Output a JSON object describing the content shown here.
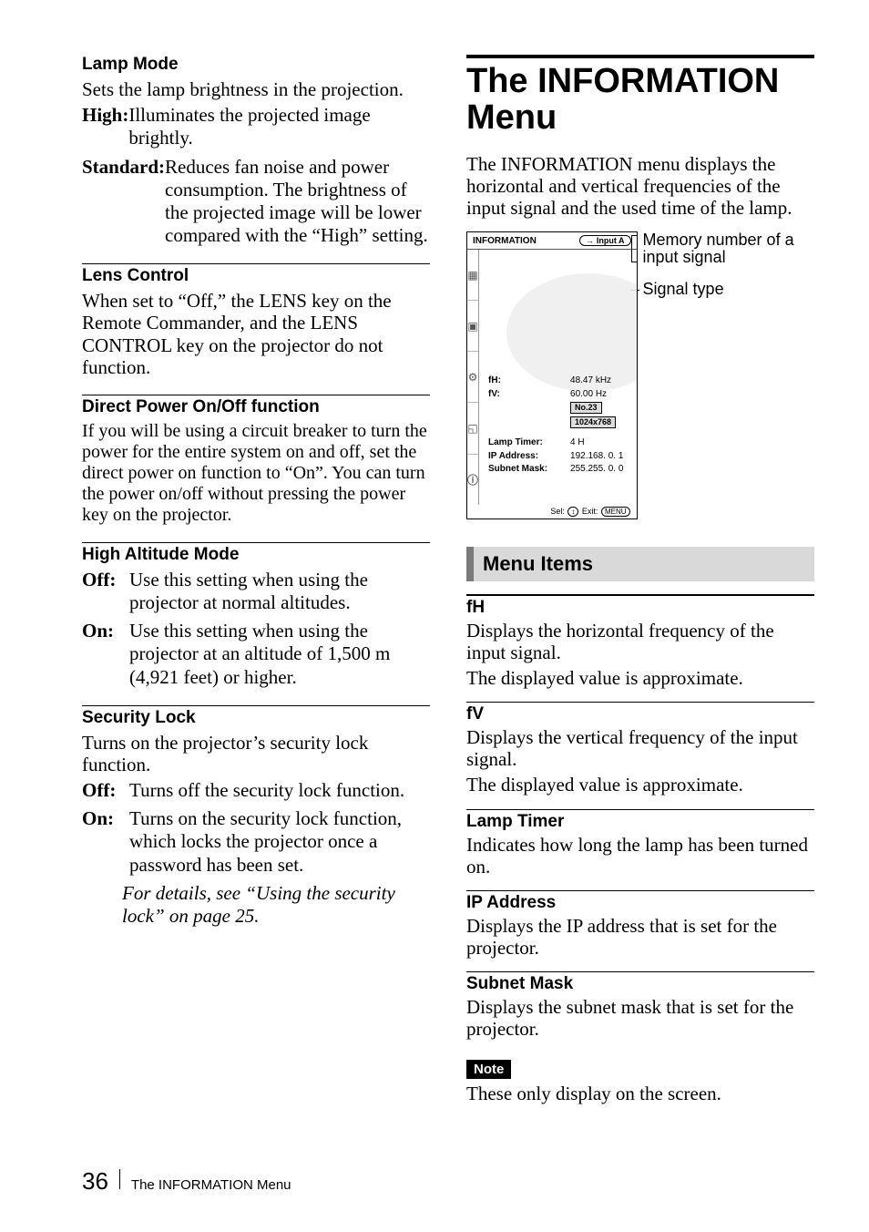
{
  "left": {
    "lamp_mode": {
      "heading": "Lamp Mode",
      "intro": "Sets the lamp brightness in the projection.",
      "high_term": "High:",
      "high_desc": "Illuminates the projected image brightly.",
      "standard_term": "Standard:",
      "standard_desc": "Reduces fan noise and power consumption.  The brightness of the projected image will be lower compared with the “High” setting."
    },
    "lens_control": {
      "heading": "Lens Control",
      "body": "When set to “Off,” the LENS key on the Remote Commander, and the LENS CONTROL key on the projector do not function."
    },
    "direct_power": {
      "heading": "Direct Power On/Off function",
      "body": "If you will be using a circuit breaker to turn the power for the entire system on and off, set the direct power on function to “On”. You can turn the power on/off without pressing the power key on the projector."
    },
    "high_altitude": {
      "heading": "High Altitude Mode",
      "off_term": "Off:",
      "off_desc": "Use this setting when using the projector at normal altitudes.",
      "on_term": "On:",
      "on_desc": "Use this setting when using the projector at an altitude of 1,500 m (4,921 feet) or higher."
    },
    "security_lock": {
      "heading": "Security Lock",
      "intro": "Turns on the projector’s security lock function.",
      "off_term": "Off:",
      "off_desc": "Turns off the security lock function.",
      "on_term": "On:",
      "on_desc": "Turns on the security lock function, which locks the projector once a password has been set.",
      "detail": "For details, see “Using the security lock” on page 25."
    }
  },
  "right": {
    "title": "The INFORMATION Menu",
    "intro": "The INFORMATION menu displays the horizontal and vertical frequencies of the input signal and the used time of the lamp.",
    "osd": {
      "title": "INFORMATION",
      "input_label": "Input A",
      "rows": {
        "fh_label": "fH:",
        "fh_value": "48.47 kHz",
        "fv_label": "fV:",
        "fv_value": "60.00 Hz",
        "memory_box": "No.23",
        "signal_box": "1024x768",
        "lamp_label": "Lamp Timer:",
        "lamp_value": "4 H",
        "ip_label": "IP Address:",
        "ip_value": "192.168.  0.  1",
        "mask_label": "Subnet Mask:",
        "mask_value": "255.255.  0.  0"
      },
      "footer_sel": "Sel:",
      "footer_exit": "Exit:",
      "footer_exit_btn": "MENU"
    },
    "callouts": {
      "memory": "Memory number of a input signal",
      "signal": "Signal type"
    },
    "section_bar": "Menu Items",
    "items": {
      "fh_head": "fH",
      "fh_body1": "Displays the horizontal frequency of the input signal.",
      "fh_body2": "The displayed value is approximate.",
      "fv_head": "fV",
      "fv_body1": "Displays the vertical frequency of the input signal.",
      "fv_body2": "The displayed value is approximate.",
      "lamp_head": "Lamp Timer",
      "lamp_body": "Indicates how long the lamp has been turned on.",
      "ip_head": "IP Address",
      "ip_body": "Displays the IP address that is set for the projector.",
      "mask_head": "Subnet Mask",
      "mask_body": "Displays the subnet mask that is set for the projector."
    },
    "note_label": "Note",
    "note_body": "These only display on the screen."
  },
  "footer": {
    "page_number": "36",
    "title": "The INFORMATION Menu"
  }
}
